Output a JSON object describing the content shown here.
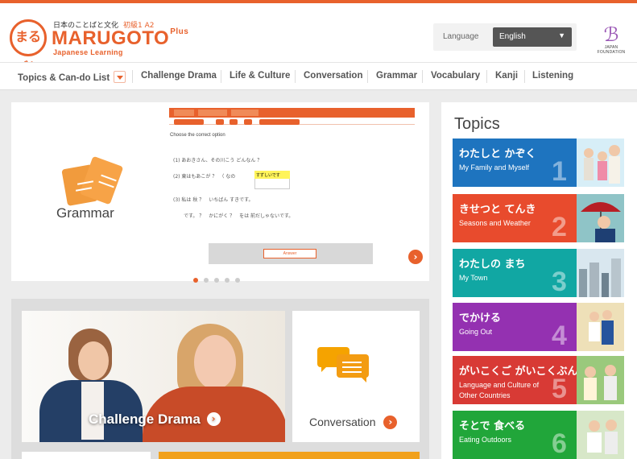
{
  "brand": {
    "logo_badge": "まるごと",
    "japanese_tagline": "日本のことばと文化",
    "level": "初級1 A2",
    "name": "MARUGOTO",
    "plus": "Plus",
    "subtitle": "Japanese Learning"
  },
  "language": {
    "label": "Language",
    "selected": "English"
  },
  "partner_logo": {
    "text": "JAPAN FOUNDATION"
  },
  "nav": {
    "items": [
      "Topics & Can-do List",
      "Challenge Drama",
      "Life & Culture",
      "Conversation",
      "Grammar",
      "Vocabulary",
      "Kanji",
      "Listening"
    ]
  },
  "slider": {
    "feature_label": "Grammar",
    "preview": {
      "question": "Choose the correct option",
      "answer_button": "Answer",
      "lines": [
        "(1) あおきさん、その川こう どんなん ？",
        "(2) 東はもあこが ？　（ なの",
        "(3) 私は 秋 ？　いちばん すきです。",
        "です。 ？　かにがく ？　をは 前だしゃないです。"
      ],
      "highlight": "すずしいです"
    },
    "dot_count": 5,
    "active_dot": 0
  },
  "features": {
    "drama_label": "Challenge Drama",
    "conversation_label": "Conversation"
  },
  "topics": {
    "title": "Topics",
    "items": [
      {
        "jp": "わたしと かぞく",
        "en": "My Family and Myself",
        "num": "1",
        "color": "#1e74bf"
      },
      {
        "jp": "きせつと てんき",
        "en": "Seasons and Weather",
        "num": "2",
        "color": "#e84b2d"
      },
      {
        "jp": "わたしの まち",
        "en": "My Town",
        "num": "3",
        "color": "#11a7a3"
      },
      {
        "jp": "でかける",
        "en": "Going Out",
        "num": "4",
        "color": "#9431b1"
      },
      {
        "jp": "がいこくご がいこくぶんか",
        "en": "Language and Culture of Other Countries",
        "num": "5",
        "color": "#d83a35"
      },
      {
        "jp": "そとで 食べる",
        "en": "Eating Outdoors",
        "num": "6",
        "color": "#21a63a"
      }
    ]
  },
  "colors": {
    "brand_orange": "#e8612c",
    "text": "#444444",
    "panel_bg": "#ececec"
  }
}
